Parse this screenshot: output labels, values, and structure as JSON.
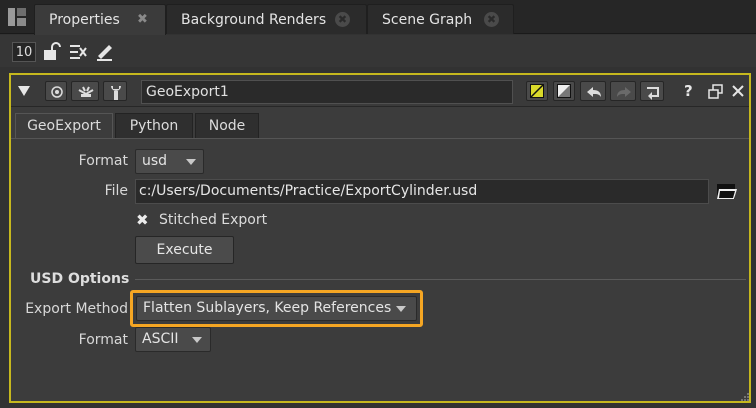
{
  "tabs": [
    {
      "label": "Properties",
      "active": true
    },
    {
      "label": "Background Renders",
      "active": false
    },
    {
      "label": "Scene Graph",
      "active": false
    }
  ],
  "tab_close_glyph": "✖",
  "toolbar": {
    "version_number": "10"
  },
  "node": {
    "name": "GeoExport1",
    "tabs": [
      {
        "label": "GeoExport",
        "active": true
      },
      {
        "label": "Python",
        "active": false
      },
      {
        "label": "Node",
        "active": false
      }
    ],
    "header_buttons": {
      "help": "?"
    }
  },
  "params": {
    "format_label": "Format",
    "format_value": "usd",
    "file_label": "File",
    "file_value": "c:/Users/Documents/Practice/ExportCylinder.usd",
    "stitched_label": "Stitched Export",
    "stitched_glyph": "✖",
    "execute_label": "Execute",
    "usd_section": "USD Options",
    "export_method_label": "Export Method",
    "export_method_value": "Flatten Sublayers, Keep References",
    "usd_format_label": "Format",
    "usd_format_value": "ASCII"
  },
  "colors": {
    "panel_border": "#c6b81e",
    "highlight": "#f5a623",
    "background": "#323232"
  }
}
